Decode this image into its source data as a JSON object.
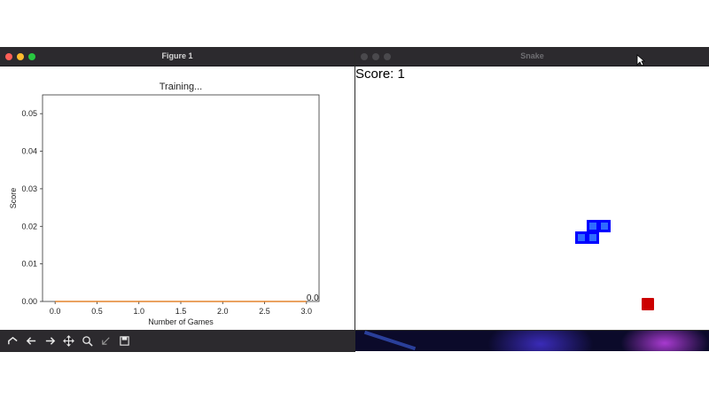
{
  "figure_window": {
    "title": "Figure 1",
    "toolbar": [
      {
        "icon": "home-icon",
        "label": ""
      },
      {
        "icon": "back-arrow-icon",
        "label": ""
      },
      {
        "icon": "forward-arrow-icon",
        "label": ""
      },
      {
        "icon": "pan-icon",
        "label": ""
      },
      {
        "icon": "zoom-icon",
        "label": ""
      },
      {
        "icon": "configure-subplots-icon",
        "label": ""
      },
      {
        "icon": "save-icon",
        "label": ""
      }
    ]
  },
  "chart_data": {
    "type": "line",
    "title": "Training...",
    "xlabel": "Number of Games",
    "ylabel": "Score",
    "xlim": [
      -0.15,
      3.15
    ],
    "ylim": [
      0,
      0.055
    ],
    "xticks": [
      "0.0",
      "0.5",
      "1.0",
      "1.5",
      "2.0",
      "2.5",
      "3.0"
    ],
    "yticks": [
      "0.00",
      "0.01",
      "0.02",
      "0.03",
      "0.04",
      "0.05"
    ],
    "series": [
      {
        "x": [
          0,
          1,
          2,
          3
        ],
        "values": [
          0,
          0,
          0,
          0
        ],
        "color": "#1f77b4"
      },
      {
        "x": [
          0,
          1,
          2,
          3
        ],
        "values": [
          0,
          0,
          0,
          0
        ],
        "color": "#ff7f0e"
      }
    ],
    "annotations": [
      {
        "x": 3,
        "y": 0,
        "text": "0.0"
      }
    ],
    "grid": false
  },
  "snake_window": {
    "title": "Snake",
    "score_text": "Score: 1",
    "snake_color": "#0000ff",
    "food_color": "#cc0000"
  }
}
